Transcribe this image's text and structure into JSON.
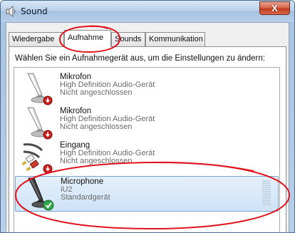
{
  "window": {
    "title": "Sound",
    "close_label": "X",
    "app_icon": "speaker-icon"
  },
  "tabs": [
    {
      "label": "Wiedergabe",
      "active": false
    },
    {
      "label": "Aufnahme",
      "active": true
    },
    {
      "label": "Sounds",
      "active": false
    },
    {
      "label": "Kommunikation",
      "active": false
    }
  ],
  "instruction": "Wählen Sie ein Aufnahmegerät aus, um die Einstellungen zu ändern:",
  "devices": [
    {
      "name": "Mikrofon",
      "driver": "High Definition Audio-Gerät",
      "status": "Nicht angeschlossen",
      "icon": "microphone-icon",
      "badge": "disconnected-icon",
      "selected": false
    },
    {
      "name": "Mikrofon",
      "driver": "High Definition Audio-Gerät",
      "status": "Nicht angeschlossen",
      "icon": "microphone-icon",
      "badge": "disconnected-icon",
      "selected": false
    },
    {
      "name": "Eingang",
      "driver": "High Definition Audio-Gerät",
      "status": "Nicht angeschlossen",
      "icon": "audio-cable-icon",
      "badge": "disconnected-icon",
      "selected": false
    },
    {
      "name": "Microphone",
      "driver": "iU2",
      "status": "Standardgerät",
      "icon": "microphone-icon",
      "badge": "default-check-icon",
      "selected": true
    }
  ],
  "colors": {
    "annotation": "#e0141e",
    "selection": "#cfe3f8",
    "disconnected_badge": "#c8201e",
    "default_badge": "#2fa84a"
  }
}
